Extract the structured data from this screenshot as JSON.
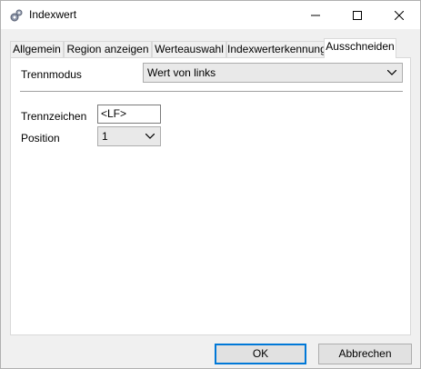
{
  "window": {
    "title": "Indexwert",
    "icon": "gears-icon"
  },
  "tabs": [
    {
      "label": "Allgemein"
    },
    {
      "label": "Region anzeigen"
    },
    {
      "label": "Werteauswahl"
    },
    {
      "label": "Indexwerterkennung"
    },
    {
      "label": "Ausschneiden"
    }
  ],
  "active_tab": "Ausschneiden",
  "form": {
    "trennmodus_label": "Trennmodus",
    "trennmodus_value": "Wert von links",
    "trennzeichen_label": "Trennzeichen",
    "trennzeichen_value": "<LF>",
    "position_label": "Position",
    "position_value": "1"
  },
  "buttons": {
    "ok": "OK",
    "cancel": "Abbrechen"
  }
}
